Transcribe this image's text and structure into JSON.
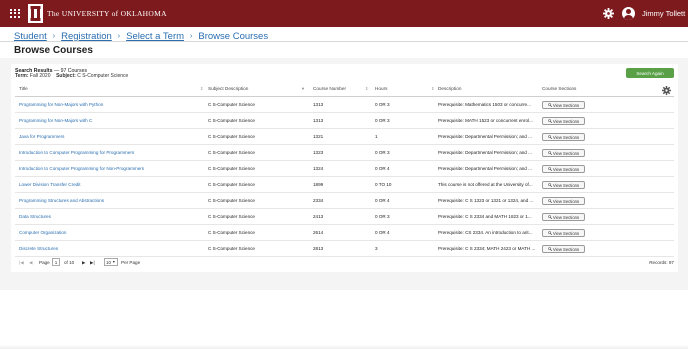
{
  "header": {
    "university_name": "The UNIVERSITY of OKLAHOMA",
    "user_name": "Jimmy Tollett"
  },
  "breadcrumb": {
    "items": [
      "Student",
      "Registration",
      "Select a Term",
      "Browse Courses"
    ],
    "separator": "›"
  },
  "page": {
    "title": "Browse Courses"
  },
  "search_results": {
    "label": "Search Results",
    "count_text": "— 97 Courses",
    "term_label": "Term:",
    "term_value": "Fall 2020",
    "subject_label": "Subject:",
    "subject_value": "C S-Computer Science",
    "search_again_label": "Search Again"
  },
  "table": {
    "columns": [
      "Title",
      "Subject Description",
      "Course Number",
      "Hours",
      "Description",
      "Course Sections"
    ],
    "view_label": "View Sections",
    "rows": [
      {
        "title": "Programming for Non-Majors with Python",
        "subject": "C S-Computer Science",
        "number": "1313",
        "hours": "0 OR 3",
        "description": "Prerequisite: Mathematics 1503 or concurre..."
      },
      {
        "title": "Programming for Non-Majors with C",
        "subject": "C S-Computer Science",
        "number": "1313",
        "hours": "0 OR 3",
        "description": "Prerequisite: MATH 1523 or concurrent enrol..."
      },
      {
        "title": "Java for Programmers",
        "subject": "C S-Computer Science",
        "number": "1321",
        "hours": "1",
        "description": "Prerequisite: Departmental Permission; and ..."
      },
      {
        "title": "Introduction to Computer Programming for Programmers",
        "subject": "C S-Computer Science",
        "number": "1323",
        "hours": "0 OR 3",
        "description": "Prerequisite: Departmental Permission; and ..."
      },
      {
        "title": "Introduction to Computer Programming for Non-Programmers",
        "subject": "C S-Computer Science",
        "number": "1324",
        "hours": "0 OR 4",
        "description": "Prerequisite: Departmental Permission; and ..."
      },
      {
        "title": "Lower Division Transfer Credit",
        "subject": "C S-Computer Science",
        "number": "1899",
        "hours": "0 TO 10",
        "description": "This course is not offered at the University of..."
      },
      {
        "title": "Programming Structures and Abstractions",
        "subject": "C S-Computer Science",
        "number": "2334",
        "hours": "0 OR 4",
        "description": "Prerequisite: C S 1323 or 1321 or 1324, and ..."
      },
      {
        "title": "Data Structures",
        "subject": "C S-Computer Science",
        "number": "2413",
        "hours": "0 OR 3",
        "description": "Prerequisite: C S 2334 and MATH 1823 or 1..."
      },
      {
        "title": "Computer Organization",
        "subject": "C S-Computer Science",
        "number": "2614",
        "hours": "0 OR 4",
        "description": "Prerequisite: CS 2334. An introduction to arit..."
      },
      {
        "title": "Discrete Structures",
        "subject": "C S-Computer Science",
        "number": "2813",
        "hours": "3",
        "description": "Prerequisite: C S 2334; MATH 2423 or MATH ..."
      }
    ]
  },
  "pager": {
    "page_label": "Page",
    "current_page": "1",
    "of_text": "of 10",
    "per_page_value": "10",
    "per_page_label": "Per Page",
    "records_text": "Records: 97"
  }
}
